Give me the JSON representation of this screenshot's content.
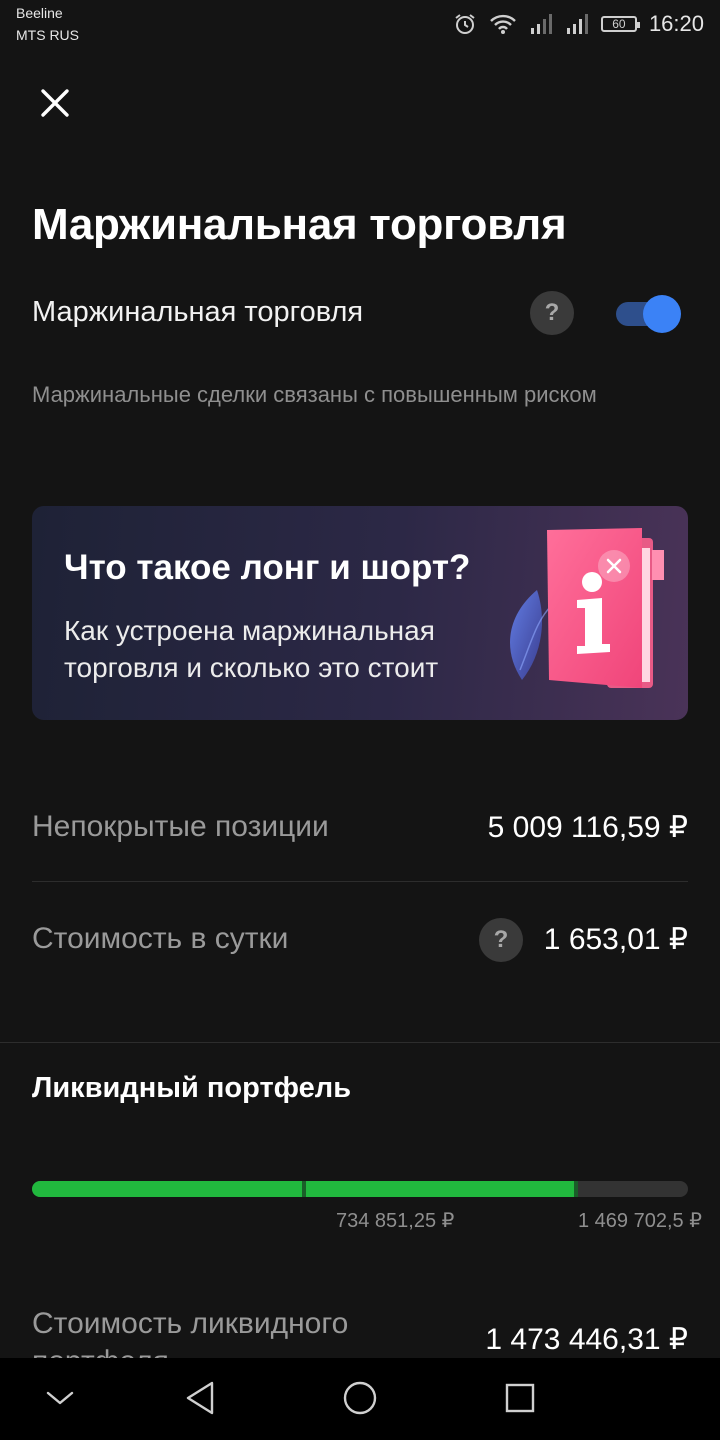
{
  "status_bar": {
    "carrier_1": "Beeline",
    "carrier_2": "MTS RUS",
    "battery": "60",
    "time": "16:20",
    "icons": [
      "alarm-icon",
      "wifi-icon",
      "signal-icon",
      "signal-icon",
      "battery-icon"
    ]
  },
  "header": {
    "close_icon": "close-icon",
    "title": "Маржинальная торговля"
  },
  "margin_toggle": {
    "label": "Маржинальная торговля",
    "help": "?",
    "enabled": true,
    "warning": "Маржинальные сделки связаны с повышенным риском"
  },
  "banner": {
    "title": "Что такое лонг и шорт?",
    "text": "Как устроена маржинальная торговля и сколько это стоит",
    "close_icon": "close-icon",
    "art_icon": "info-book-icon"
  },
  "stats": [
    {
      "label": "Непокрытые позиции",
      "value": "5 009 116,59 ₽"
    },
    {
      "label": "Стоимость в сутки",
      "value": "1 653,01 ₽",
      "help": "?"
    }
  ],
  "liquid_portfolio": {
    "title": "Ликвидный портфель",
    "fill_fraction": 0.828,
    "marks_fraction": [
      0.415,
      0.83
    ],
    "ticks": [
      "734 851,25 ₽",
      "1 469 702,5 ₽"
    ],
    "value_label": "Стоимость ликвидного портфеля",
    "value": "1 473 446,31 ₽"
  },
  "colors": {
    "background": "#141414",
    "accent_blue": "#3b82f6",
    "progress_green": "#21b83e"
  },
  "nav_bar": {
    "icons": [
      "chevron-down-icon",
      "back-icon",
      "home-icon",
      "recents-icon"
    ]
  }
}
